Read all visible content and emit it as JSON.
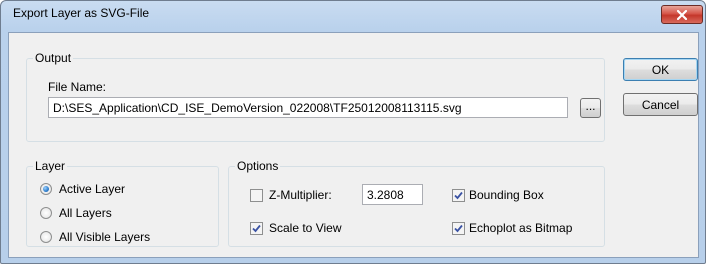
{
  "window": {
    "title": "Export Layer as SVG-File",
    "close_glyph": "close-icon"
  },
  "output": {
    "group_label": "Output",
    "file_name_label": "File Name:",
    "file_name_value": "D:\\SES_Application\\CD_ISE_DemoVersion_022008\\TF25012008113115.svg",
    "browse_label": "..."
  },
  "buttons": {
    "ok": "OK",
    "cancel": "Cancel"
  },
  "layer": {
    "group_label": "Layer",
    "options": [
      {
        "label": "Active Layer",
        "selected": true
      },
      {
        "label": "All Layers",
        "selected": false
      },
      {
        "label": "All Visible Layers",
        "selected": false
      }
    ]
  },
  "options": {
    "group_label": "Options",
    "z_multiplier": {
      "label": "Z-Multiplier:",
      "checked": false,
      "value": "3.2808"
    },
    "bounding_box": {
      "label": "Bounding Box",
      "checked": true
    },
    "scale_to_view": {
      "label": "Scale to View",
      "checked": true
    },
    "echoplot_as_bitmap": {
      "label": "Echoplot as Bitmap",
      "checked": true
    }
  },
  "colors": {
    "title_bar": "#b9d1ec",
    "close_button": "#c4372b",
    "client_background": "#f0f0f0"
  }
}
